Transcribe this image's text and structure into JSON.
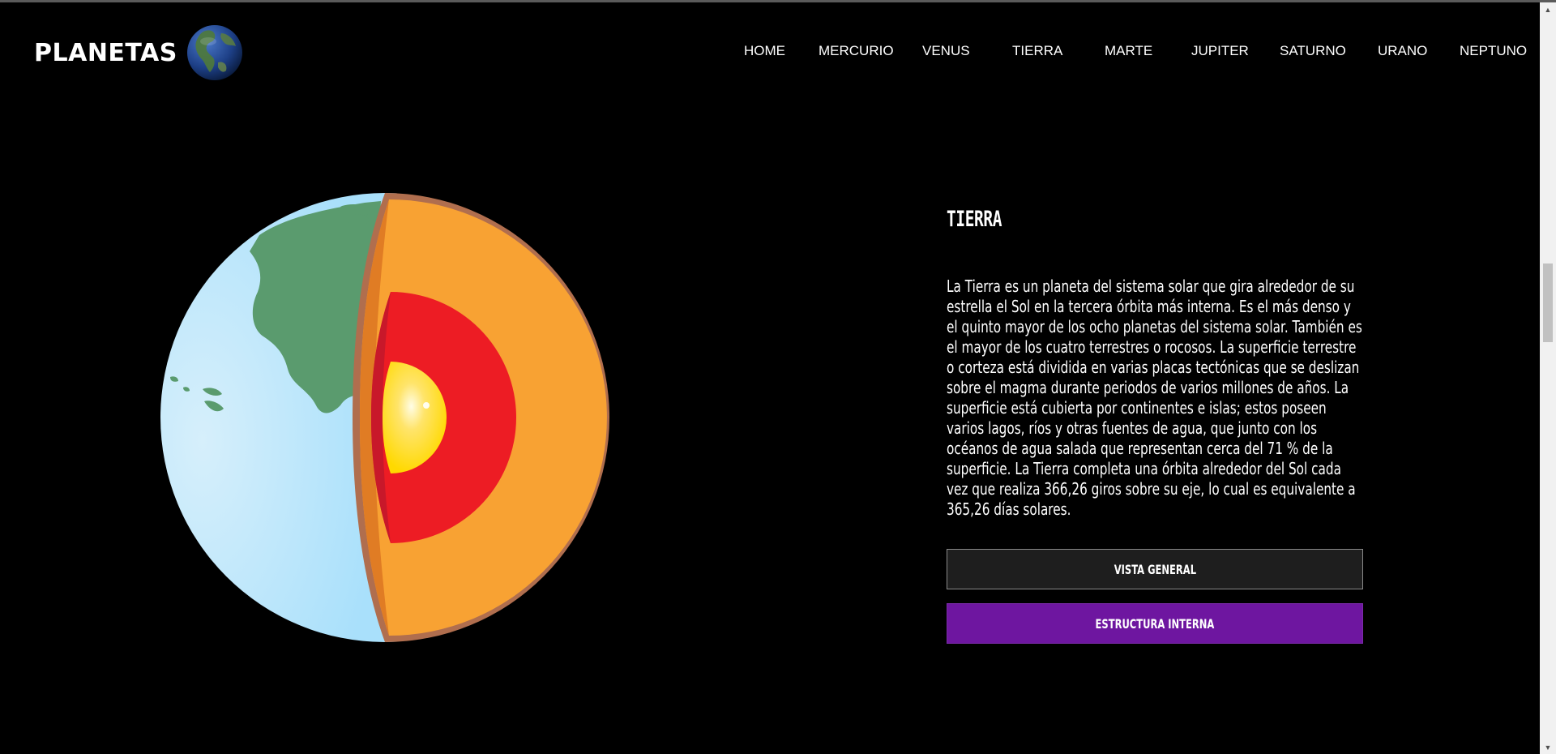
{
  "brand": {
    "title": "PLANETAS",
    "globe_icon": "earth-globe-icon"
  },
  "nav": {
    "items": [
      "HOME",
      "MERCURIO",
      "VENUS",
      "TIERRA",
      "MARTE",
      "JUPITER",
      "SATURNO",
      "URANO",
      "NEPTUNO"
    ]
  },
  "figure": {
    "name": "earth-internal-structure-image"
  },
  "planet": {
    "title": "TIERRA",
    "description_lines": [
      "La Tierra es un planeta del sistema solar que gira alrededor de su",
      "estrella el Sol en la tercera órbita más interna. Es el más denso y",
      "el quinto mayor de los ocho planetas del sistema solar. También es",
      "el mayor de los cuatro terrestres o rocosos. La superficie terrestre",
      "o corteza está dividida en varias placas tectónicas que se deslizan",
      "sobre el magma durante periodos de varios millones de años. La",
      "superficie está cubierta por continentes e islas; estos poseen",
      "varios lagos, ríos y otras fuentes de agua, que junto con los",
      "océanos de agua salada que representan cerca del 71 % de la",
      "superficie. La Tierra completa una órbita alrededor del Sol cada",
      "vez que realiza 366,26 giros sobre su eje, lo cual es equivalente a",
      "365,26 días solares."
    ]
  },
  "buttons": {
    "general": "VISTA GENERAL",
    "interna": "ESTRUCTURA INTERNA"
  },
  "colors": {
    "background": "#000000",
    "active_button": "#6e16a0",
    "inactive_button": "#1e1e1e"
  }
}
